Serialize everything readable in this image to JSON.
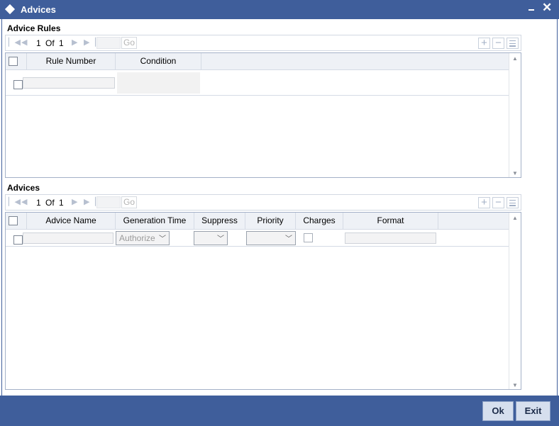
{
  "window": {
    "title": "Advices",
    "minimize_icon": "minimize-icon",
    "close_icon": "close-icon",
    "close_glyph": "✕"
  },
  "advice_rules": {
    "label": "Advice Rules",
    "pagination": {
      "current": "1",
      "of": "Of",
      "total": "1",
      "go_label": "Go"
    },
    "columns": [
      "Rule Number",
      "Condition"
    ],
    "row": {
      "rule_number": "",
      "condition": ""
    }
  },
  "advices": {
    "label": "Advices",
    "pagination": {
      "current": "1",
      "of": "Of",
      "total": "1",
      "go_label": "Go"
    },
    "columns": [
      "Advice Name",
      "Generation Time",
      "Suppress",
      "Priority",
      "Charges",
      "Format"
    ],
    "row": {
      "advice_name": "",
      "generation_time": "Authorize",
      "suppress": "",
      "priority": "",
      "charges": false,
      "format": ""
    }
  },
  "footer": {
    "ok_label": "Ok",
    "exit_label": "Exit"
  },
  "colors": {
    "titlebar": "#3f5e9b",
    "header_bg": "#eef1f6",
    "button_bg": "#d6dfee"
  }
}
